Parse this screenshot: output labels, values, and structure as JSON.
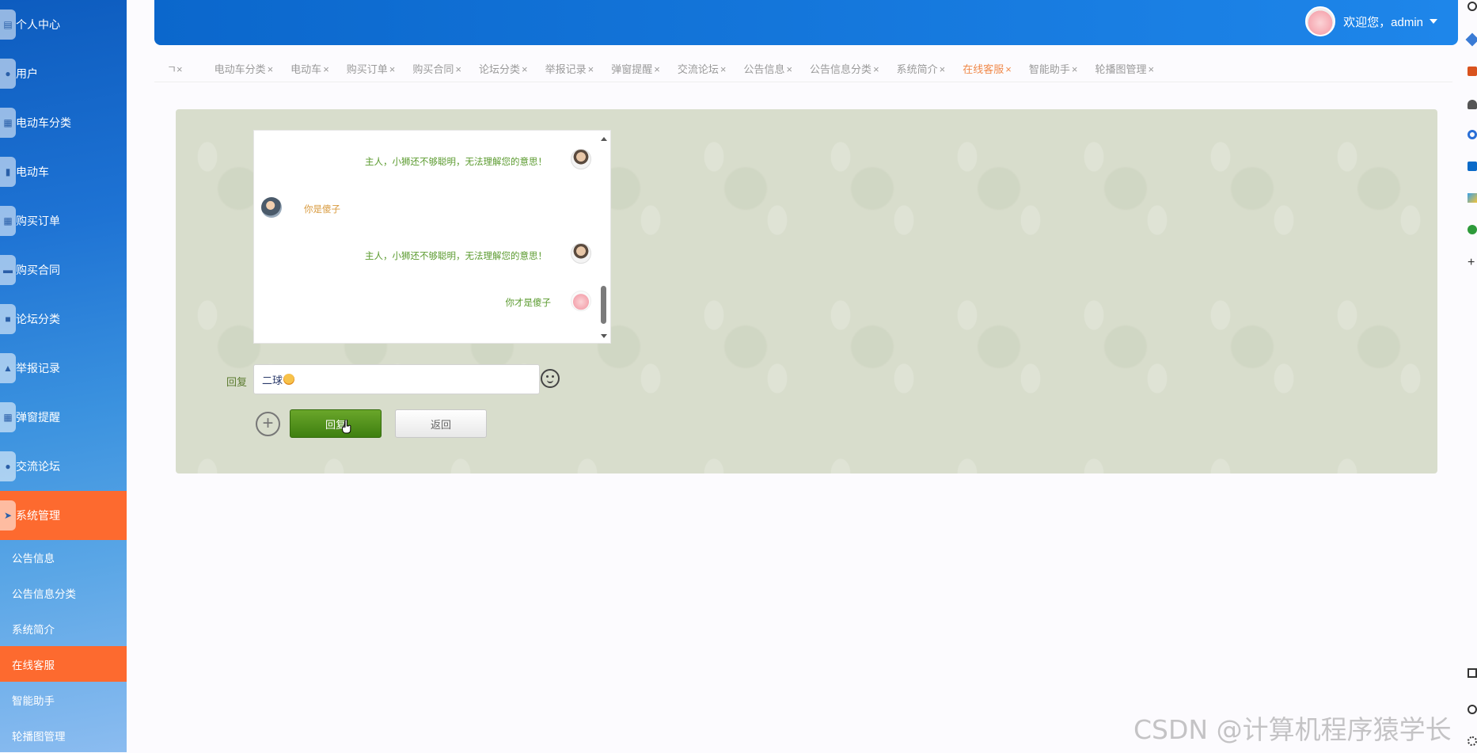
{
  "sidebar": {
    "items": [
      {
        "icon": "home-icon",
        "label": "个人中心"
      },
      {
        "icon": "user-icon",
        "label": "用户"
      },
      {
        "icon": "grid-icon",
        "label": "电动车分类"
      },
      {
        "icon": "file-icon",
        "label": "电动车"
      },
      {
        "icon": "grid-icon",
        "label": "购买订单"
      },
      {
        "icon": "chat-icon",
        "label": "购买合同"
      },
      {
        "icon": "square-icon",
        "label": "论坛分类"
      },
      {
        "icon": "home-icon",
        "label": "举报记录"
      },
      {
        "icon": "grid-icon",
        "label": "弹窗提醒"
      },
      {
        "icon": "bubble-icon",
        "label": "交流论坛"
      },
      {
        "icon": "send-icon",
        "label": "系统管理"
      }
    ],
    "sub_items": [
      "公告信息",
      "公告信息分类",
      "系统简介",
      "在线客服",
      "智能助手",
      "轮播图管理"
    ]
  },
  "header": {
    "welcome": "欢迎您，admin"
  },
  "tabs": [
    "电动车分类",
    "电动车",
    "购买订单",
    "购买合同",
    "论坛分类",
    "举报记录",
    "弹窗提醒",
    "交流论坛",
    "公告信息",
    "公告信息分类",
    "系统简介",
    "在线客服",
    "智能助手",
    "轮播图管理"
  ],
  "tab_close": "×",
  "chat": {
    "messages": [
      {
        "side": "right",
        "text": "主人，小狮还不够聪明，无法理解您的意思！"
      },
      {
        "side": "left",
        "text": "你是傻子"
      },
      {
        "side": "right",
        "text": "主人，小狮还不够聪明，无法理解您的意思！"
      },
      {
        "side": "right",
        "text": "你才是傻子"
      }
    ]
  },
  "reply": {
    "label": "回复",
    "value": "二球",
    "reply_button": "回复",
    "back_button": "返回"
  },
  "watermark": "CSDN @计算机程序猿学长",
  "colors": {
    "sidebar_active": "#fd6a2f",
    "header": "#1577dd",
    "reply_button": "#4f8f1c",
    "active_tab": "#f08a4b"
  }
}
